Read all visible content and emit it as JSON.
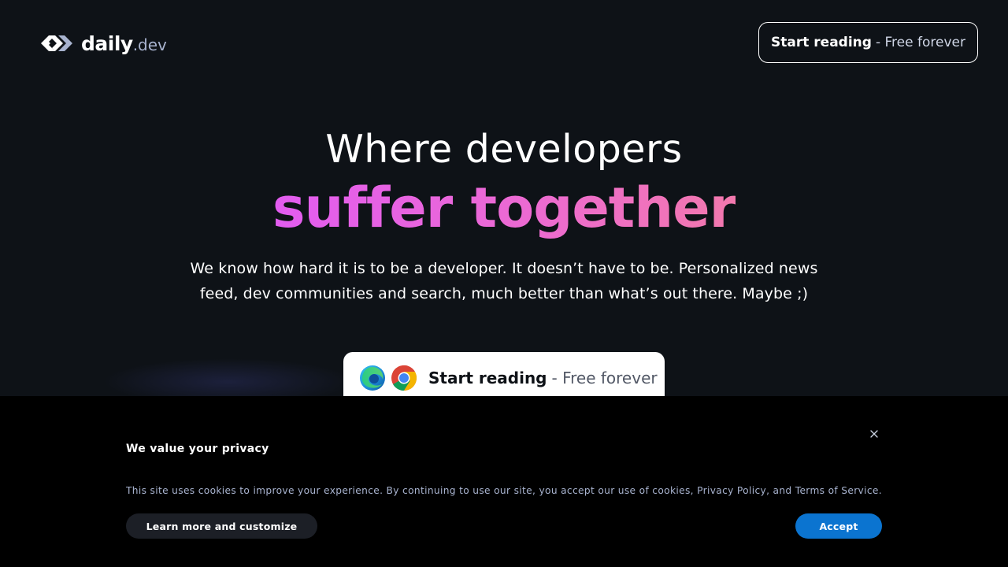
{
  "brand": {
    "name": "daily",
    "suffix": ".dev"
  },
  "header": {
    "cta_bold": "Start reading",
    "cta_light": "- Free forever"
  },
  "hero": {
    "title_line1": "Where developers",
    "title_line2": "suffer together",
    "description": "We know how hard it is to be a developer. It doesn’t have to be. Personalized news feed, dev communities and search, much better than what’s out there. Maybe ;)",
    "cta_bold": "Start reading",
    "cta_light": "- Free forever",
    "gradient_colors": [
      "#e25cf0",
      "#f278ad"
    ]
  },
  "cookie": {
    "title": "We value your privacy",
    "text_before": "This site uses cookies to improve your experience. By continuing to use our site, you accept our use of cookies, ",
    "privacy_link": "Privacy Policy",
    "text_middle": ", and ",
    "terms_link": "Terms of Service",
    "text_after": ".",
    "customize_label": "Learn more and customize",
    "accept_label": "Accept",
    "accept_color": "#0b74d0"
  },
  "icons": {
    "logo": "daily-dev-logo-icon",
    "edge": "edge-browser-icon",
    "chrome": "chrome-browser-icon",
    "close": "close-icon"
  }
}
